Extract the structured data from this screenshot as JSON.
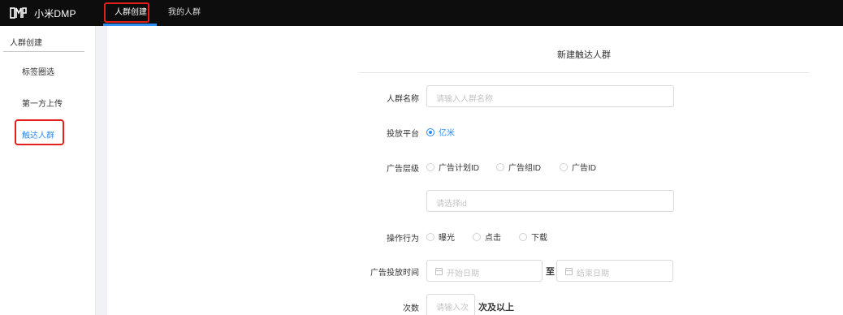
{
  "app": {
    "brand": "小米DMP"
  },
  "topnav": {
    "tabs": [
      {
        "label": "人群创建"
      },
      {
        "label": "我的人群"
      }
    ]
  },
  "sidebar": {
    "title": "人群创建",
    "items": [
      {
        "label": "标签圈选"
      },
      {
        "label": "第一方上传"
      },
      {
        "label": "触达人群"
      }
    ]
  },
  "form": {
    "title": "新建触达人群",
    "name": {
      "label": "人群名称",
      "placeholder": "请输入人群名称"
    },
    "platform": {
      "label": "投放平台",
      "options": [
        {
          "label": "亿米",
          "selected": true
        }
      ]
    },
    "ad_level": {
      "label": "广告层级",
      "options": [
        {
          "label": "广告计划ID"
        },
        {
          "label": "广告组ID"
        },
        {
          "label": "广告ID"
        }
      ],
      "placeholder": "请选择id"
    },
    "action": {
      "label": "操作行为",
      "options": [
        {
          "label": "曝光"
        },
        {
          "label": "点击"
        },
        {
          "label": "下载"
        }
      ]
    },
    "date": {
      "label": "广告投放时间",
      "start_placeholder": "开始日期",
      "separator": "至",
      "end_placeholder": "结束日期"
    },
    "count": {
      "label": "次数",
      "placeholder": "请输入次",
      "suffix": "次及以上"
    }
  },
  "colors": {
    "accent": "#2f8df0",
    "topbar": "#0d0d0d",
    "highlight": "#e21f18"
  },
  "icons": {
    "logo": "dmp-logo-icon",
    "calendar": "calendar-icon"
  }
}
